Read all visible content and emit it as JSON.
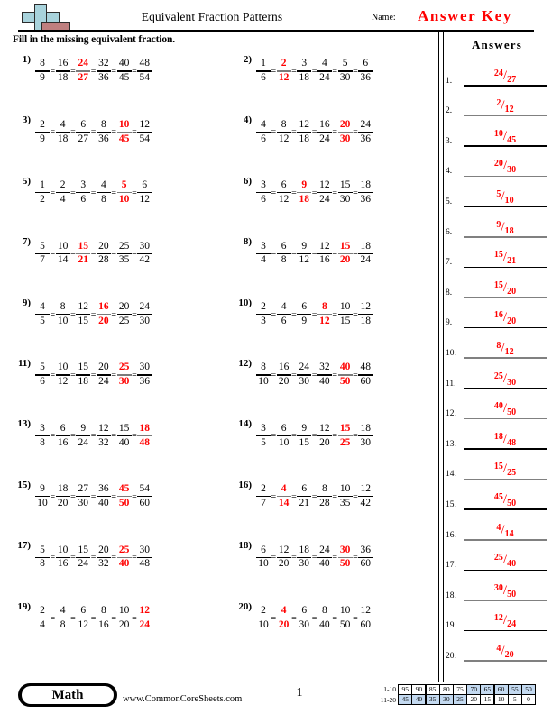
{
  "header": {
    "title": "Equivalent Fraction Patterns",
    "name_label": "Name:",
    "answer_key": "Answer Key",
    "logo_colors": {
      "plus": "#a8d3dc",
      "block": "#bf7f7f"
    }
  },
  "instruction": "Fill in the missing equivalent fraction.",
  "answers_panel": {
    "title": "Answers"
  },
  "colors": {
    "answer_red": "#ff0000",
    "highlight_blue": "#c3d9f0",
    "gray_rule": "#808080"
  },
  "problems": [
    {
      "number": "1)",
      "missing_index": 2,
      "fractions": [
        {
          "n": "8",
          "d": "9"
        },
        {
          "n": "16",
          "d": "18"
        },
        {
          "n": "24",
          "d": "27"
        },
        {
          "n": "32",
          "d": "36"
        },
        {
          "n": "40",
          "d": "45"
        },
        {
          "n": "48",
          "d": "54"
        }
      ]
    },
    {
      "number": "2)",
      "missing_index": 1,
      "fractions": [
        {
          "n": "1",
          "d": "6"
        },
        {
          "n": "2",
          "d": "12"
        },
        {
          "n": "3",
          "d": "18"
        },
        {
          "n": "4",
          "d": "24"
        },
        {
          "n": "5",
          "d": "30"
        },
        {
          "n": "6",
          "d": "36"
        }
      ]
    },
    {
      "number": "3)",
      "missing_index": 4,
      "fractions": [
        {
          "n": "2",
          "d": "9"
        },
        {
          "n": "4",
          "d": "18"
        },
        {
          "n": "6",
          "d": "27"
        },
        {
          "n": "8",
          "d": "36"
        },
        {
          "n": "10",
          "d": "45"
        },
        {
          "n": "12",
          "d": "54"
        }
      ]
    },
    {
      "number": "4)",
      "missing_index": 4,
      "fractions": [
        {
          "n": "4",
          "d": "6"
        },
        {
          "n": "8",
          "d": "12"
        },
        {
          "n": "12",
          "d": "18"
        },
        {
          "n": "16",
          "d": "24"
        },
        {
          "n": "20",
          "d": "30"
        },
        {
          "n": "24",
          "d": "36"
        }
      ]
    },
    {
      "number": "5)",
      "missing_index": 4,
      "fractions": [
        {
          "n": "1",
          "d": "2"
        },
        {
          "n": "2",
          "d": "4"
        },
        {
          "n": "3",
          "d": "6"
        },
        {
          "n": "4",
          "d": "8"
        },
        {
          "n": "5",
          "d": "10"
        },
        {
          "n": "6",
          "d": "12"
        }
      ]
    },
    {
      "number": "6)",
      "missing_index": 2,
      "fractions": [
        {
          "n": "3",
          "d": "6"
        },
        {
          "n": "6",
          "d": "12"
        },
        {
          "n": "9",
          "d": "18"
        },
        {
          "n": "12",
          "d": "24"
        },
        {
          "n": "15",
          "d": "30"
        },
        {
          "n": "18",
          "d": "36"
        }
      ]
    },
    {
      "number": "7)",
      "missing_index": 2,
      "fractions": [
        {
          "n": "5",
          "d": "7"
        },
        {
          "n": "10",
          "d": "14"
        },
        {
          "n": "15",
          "d": "21"
        },
        {
          "n": "20",
          "d": "28"
        },
        {
          "n": "25",
          "d": "35"
        },
        {
          "n": "30",
          "d": "42"
        }
      ]
    },
    {
      "number": "8)",
      "missing_index": 4,
      "fractions": [
        {
          "n": "3",
          "d": "4"
        },
        {
          "n": "6",
          "d": "8"
        },
        {
          "n": "9",
          "d": "12"
        },
        {
          "n": "12",
          "d": "16"
        },
        {
          "n": "15",
          "d": "20"
        },
        {
          "n": "18",
          "d": "24"
        }
      ]
    },
    {
      "number": "9)",
      "missing_index": 3,
      "fractions": [
        {
          "n": "4",
          "d": "5"
        },
        {
          "n": "8",
          "d": "10"
        },
        {
          "n": "12",
          "d": "15"
        },
        {
          "n": "16",
          "d": "20"
        },
        {
          "n": "20",
          "d": "25"
        },
        {
          "n": "24",
          "d": "30"
        }
      ]
    },
    {
      "number": "10)",
      "missing_index": 3,
      "fractions": [
        {
          "n": "2",
          "d": "3"
        },
        {
          "n": "4",
          "d": "6"
        },
        {
          "n": "6",
          "d": "9"
        },
        {
          "n": "8",
          "d": "12"
        },
        {
          "n": "10",
          "d": "15"
        },
        {
          "n": "12",
          "d": "18"
        }
      ]
    },
    {
      "number": "11)",
      "missing_index": 4,
      "fractions": [
        {
          "n": "5",
          "d": "6"
        },
        {
          "n": "10",
          "d": "12"
        },
        {
          "n": "15",
          "d": "18"
        },
        {
          "n": "20",
          "d": "24"
        },
        {
          "n": "25",
          "d": "30"
        },
        {
          "n": "30",
          "d": "36"
        }
      ]
    },
    {
      "number": "12)",
      "missing_index": 4,
      "fractions": [
        {
          "n": "8",
          "d": "10"
        },
        {
          "n": "16",
          "d": "20"
        },
        {
          "n": "24",
          "d": "30"
        },
        {
          "n": "32",
          "d": "40"
        },
        {
          "n": "40",
          "d": "50"
        },
        {
          "n": "48",
          "d": "60"
        }
      ]
    },
    {
      "number": "13)",
      "missing_index": 5,
      "fractions": [
        {
          "n": "3",
          "d": "8"
        },
        {
          "n": "6",
          "d": "16"
        },
        {
          "n": "9",
          "d": "24"
        },
        {
          "n": "12",
          "d": "32"
        },
        {
          "n": "15",
          "d": "40"
        },
        {
          "n": "18",
          "d": "48"
        }
      ]
    },
    {
      "number": "14)",
      "missing_index": 4,
      "fractions": [
        {
          "n": "3",
          "d": "5"
        },
        {
          "n": "6",
          "d": "10"
        },
        {
          "n": "9",
          "d": "15"
        },
        {
          "n": "12",
          "d": "20"
        },
        {
          "n": "15",
          "d": "25"
        },
        {
          "n": "18",
          "d": "30"
        }
      ]
    },
    {
      "number": "15)",
      "missing_index": 4,
      "fractions": [
        {
          "n": "9",
          "d": "10"
        },
        {
          "n": "18",
          "d": "20"
        },
        {
          "n": "27",
          "d": "30"
        },
        {
          "n": "36",
          "d": "40"
        },
        {
          "n": "45",
          "d": "50"
        },
        {
          "n": "54",
          "d": "60"
        }
      ]
    },
    {
      "number": "16)",
      "missing_index": 1,
      "fractions": [
        {
          "n": "2",
          "d": "7"
        },
        {
          "n": "4",
          "d": "14"
        },
        {
          "n": "6",
          "d": "21"
        },
        {
          "n": "8",
          "d": "28"
        },
        {
          "n": "10",
          "d": "35"
        },
        {
          "n": "12",
          "d": "42"
        }
      ]
    },
    {
      "number": "17)",
      "missing_index": 4,
      "fractions": [
        {
          "n": "5",
          "d": "8"
        },
        {
          "n": "10",
          "d": "16"
        },
        {
          "n": "15",
          "d": "24"
        },
        {
          "n": "20",
          "d": "32"
        },
        {
          "n": "25",
          "d": "40"
        },
        {
          "n": "30",
          "d": "48"
        }
      ]
    },
    {
      "number": "18)",
      "missing_index": 4,
      "fractions": [
        {
          "n": "6",
          "d": "10"
        },
        {
          "n": "12",
          "d": "20"
        },
        {
          "n": "18",
          "d": "30"
        },
        {
          "n": "24",
          "d": "40"
        },
        {
          "n": "30",
          "d": "50"
        },
        {
          "n": "36",
          "d": "60"
        }
      ]
    },
    {
      "number": "19)",
      "missing_index": 5,
      "fractions": [
        {
          "n": "2",
          "d": "4"
        },
        {
          "n": "4",
          "d": "8"
        },
        {
          "n": "6",
          "d": "12"
        },
        {
          "n": "8",
          "d": "16"
        },
        {
          "n": "10",
          "d": "20"
        },
        {
          "n": "12",
          "d": "24"
        }
      ]
    },
    {
      "number": "20)",
      "missing_index": 1,
      "fractions": [
        {
          "n": "2",
          "d": "10"
        },
        {
          "n": "4",
          "d": "20"
        },
        {
          "n": "6",
          "d": "30"
        },
        {
          "n": "8",
          "d": "40"
        },
        {
          "n": "10",
          "d": "50"
        },
        {
          "n": "12",
          "d": "60"
        }
      ]
    }
  ],
  "answers": [
    {
      "index": "1.",
      "num": "24",
      "den": "27"
    },
    {
      "index": "2.",
      "num": "2",
      "den": "12"
    },
    {
      "index": "3.",
      "num": "10",
      "den": "45"
    },
    {
      "index": "4.",
      "num": "20",
      "den": "30"
    },
    {
      "index": "5.",
      "num": "5",
      "den": "10"
    },
    {
      "index": "6.",
      "num": "9",
      "den": "18"
    },
    {
      "index": "7.",
      "num": "15",
      "den": "21"
    },
    {
      "index": "8.",
      "num": "15",
      "den": "20"
    },
    {
      "index": "9.",
      "num": "16",
      "den": "20"
    },
    {
      "index": "10.",
      "num": "8",
      "den": "12"
    },
    {
      "index": "11.",
      "num": "25",
      "den": "30"
    },
    {
      "index": "12.",
      "num": "40",
      "den": "50"
    },
    {
      "index": "13.",
      "num": "18",
      "den": "48"
    },
    {
      "index": "14.",
      "num": "15",
      "den": "25"
    },
    {
      "index": "15.",
      "num": "45",
      "den": "50"
    },
    {
      "index": "16.",
      "num": "4",
      "den": "14"
    },
    {
      "index": "17.",
      "num": "25",
      "den": "40"
    },
    {
      "index": "18.",
      "num": "30",
      "den": "50"
    },
    {
      "index": "19.",
      "num": "12",
      "den": "24"
    },
    {
      "index": "20.",
      "num": "4",
      "den": "20"
    }
  ],
  "footer": {
    "subject_badge": "Math",
    "site_url": "www.CommonCoreSheets.com",
    "page_number": "1",
    "score_table": {
      "rows": [
        {
          "label": "1-10",
          "cells": [
            {
              "v": "95",
              "hl": false
            },
            {
              "v": "90",
              "hl": false
            },
            {
              "v": "85",
              "hl": false
            },
            {
              "v": "80",
              "hl": false
            },
            {
              "v": "75",
              "hl": false
            },
            {
              "v": "70",
              "hl": true
            },
            {
              "v": "65",
              "hl": true
            },
            {
              "v": "60",
              "hl": true
            },
            {
              "v": "55",
              "hl": true
            },
            {
              "v": "50",
              "hl": true
            }
          ]
        },
        {
          "label": "11-20",
          "cells": [
            {
              "v": "45",
              "hl": true
            },
            {
              "v": "40",
              "hl": true
            },
            {
              "v": "35",
              "hl": true
            },
            {
              "v": "30",
              "hl": true
            },
            {
              "v": "25",
              "hl": true
            },
            {
              "v": "20",
              "hl": false
            },
            {
              "v": "15",
              "hl": false
            },
            {
              "v": "10",
              "hl": false
            },
            {
              "v": "5",
              "hl": false
            },
            {
              "v": "0",
              "hl": false
            }
          ]
        }
      ]
    }
  }
}
